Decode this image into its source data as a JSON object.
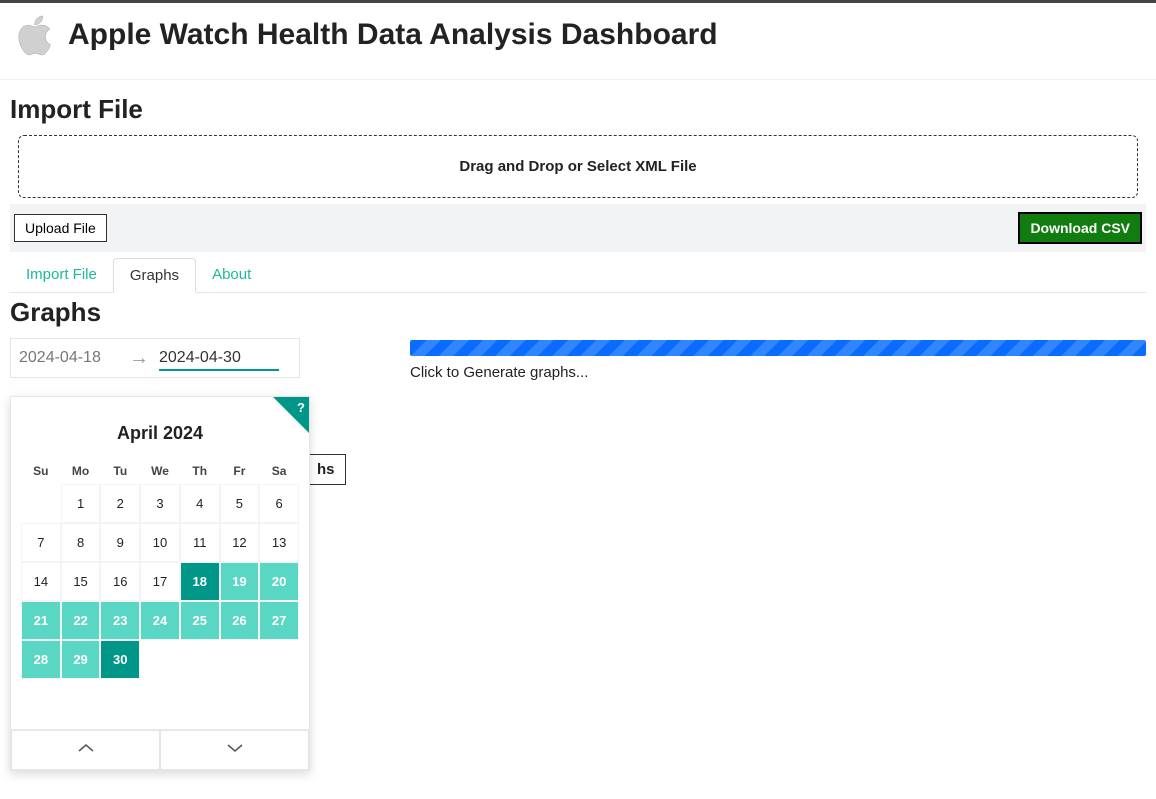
{
  "header": {
    "title": "Apple Watch Health Data Analysis Dashboard"
  },
  "import": {
    "section_title": "Import File",
    "dropzone_text": "Drag and Drop or Select XML File",
    "upload_button": "Upload File",
    "download_button": "Download CSV"
  },
  "tabs": {
    "import": "Import File",
    "graphs": "Graphs",
    "about": "About",
    "active": "graphs"
  },
  "graphs": {
    "section_title": "Graphs",
    "generate_button_partial": "hs",
    "progress_text": "Click to Generate graphs..."
  },
  "date_range": {
    "start": "2024-04-18",
    "end": "2024-04-30"
  },
  "calendar": {
    "help": "?",
    "month_title": "April 2024",
    "weekdays": [
      "Su",
      "Mo",
      "Tu",
      "We",
      "Th",
      "Fr",
      "Sa"
    ],
    "leading_blanks": 1,
    "days_in_month": 30,
    "selected_start": 18,
    "selected_end": 30,
    "nav_prev": "⌃",
    "nav_next": "⌄"
  },
  "colors": {
    "accent": "#009688",
    "range": "#5ad6c4",
    "download_bg": "#117d11",
    "progress_a": "#0a6cff",
    "progress_b": "#2f86ff"
  }
}
